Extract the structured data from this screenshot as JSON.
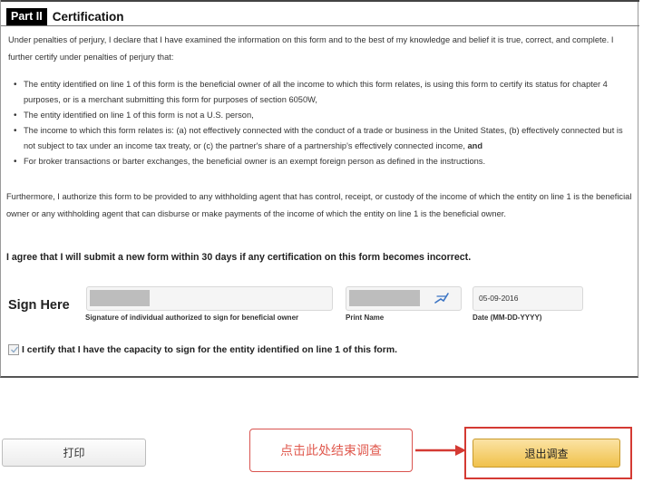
{
  "part": {
    "badge": "Part II",
    "title": "Certification"
  },
  "intro_text": "Under penalties of perjury, I declare that I have examined the information on this form and to the best of my knowledge and belief it is true, correct, and complete. I further certify under penalties of perjury that:",
  "bullets": [
    "The entity identified on line 1 of this form is the beneficial owner of all the income to which this form relates, is using this form to certify its status for chapter 4 purposes, or is a merchant submitting this form for purposes of section 6050W,",
    "The entity identified on line 1 of this form is not a U.S. person,",
    "The income to which this form relates is: (a) not effectively connected with the conduct of a trade or business in the United States, (b) effectively connected but is not subject to tax under an income tax treaty, or (c) the partner's share of a partnership's effectively connected income,",
    "For broker transactions or barter exchanges, the beneficial owner is an exempt foreign person as defined in the instructions."
  ],
  "bullet3_bold_tail": "and",
  "further_text": "Furthermore, I authorize this form to be provided to any withholding agent that has control, receipt, or custody of the income of which the entity on line 1 is the beneficial owner or any withholding agent that can disburse or make payments of the income of which the entity on line 1 is the beneficial owner.",
  "agree_text": "I agree that I will submit a new form within 30 days if any certification on this form becomes incorrect.",
  "sign": {
    "heading": "Sign Here",
    "signature_label": "Signature of individual authorized to sign for beneficial owner",
    "print_name_label": "Print Name",
    "date_label": "Date (MM-DD-YYYY)",
    "date_value": "05-09-2016"
  },
  "capacity_checkbox": {
    "checked": true,
    "label": "I certify that I have the capacity to sign for the entity identified on line 1 of this form."
  },
  "buttons": {
    "print_label": "打印",
    "exit_label": "退出调查"
  },
  "annotation": {
    "text": "点击此处结束调查",
    "color": "#d9534f"
  },
  "icons": {
    "pen": "pen-icon",
    "check": "check-icon",
    "arrow": "arrow-right-icon"
  }
}
